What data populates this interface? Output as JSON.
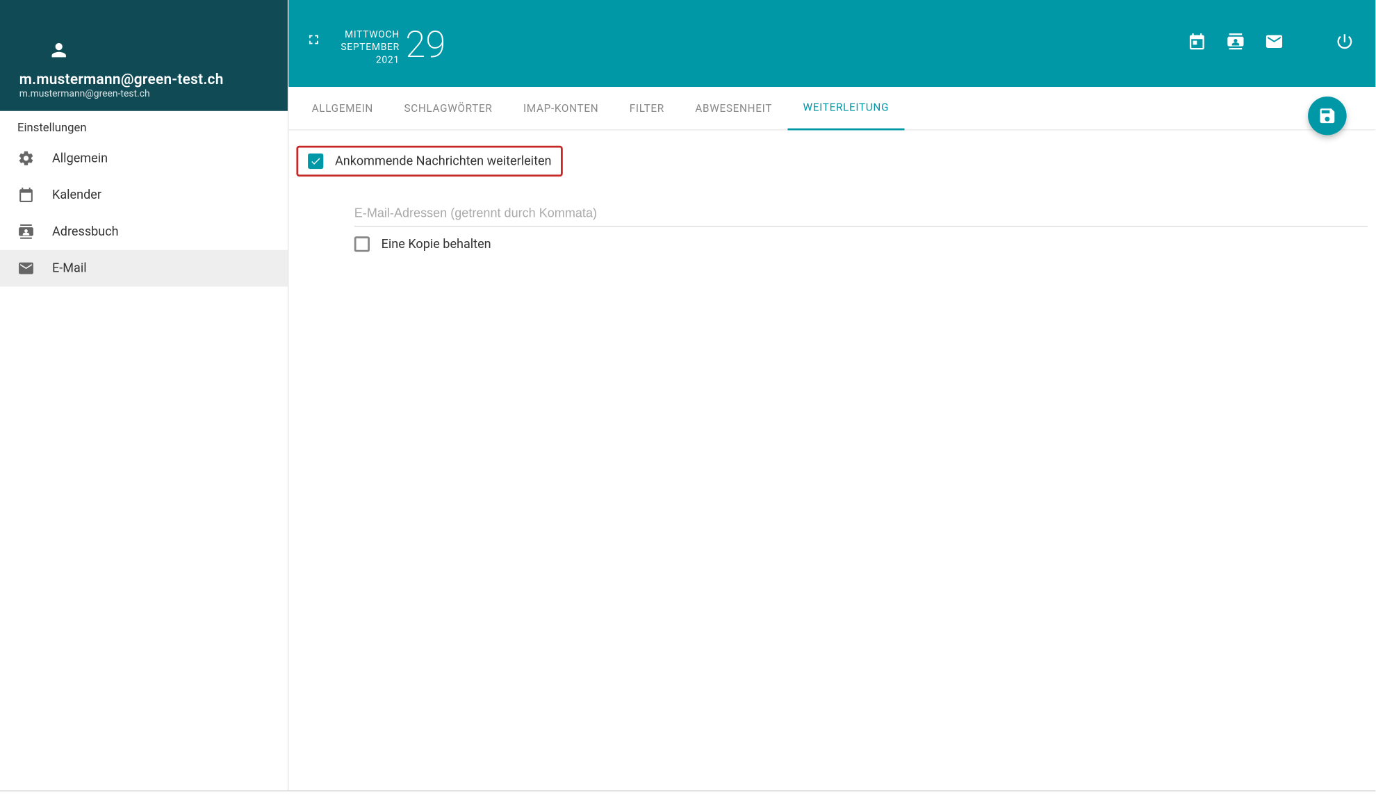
{
  "colors": {
    "primary": "#0097a7",
    "sidebar_header": "#104a55",
    "highlight": "#c62828"
  },
  "user": {
    "email": "m.mustermann@green-test.ch",
    "subemail": "m.mustermann@green-test.ch"
  },
  "sidebar": {
    "title": "Einstellungen",
    "items": [
      {
        "label": "Allgemein",
        "icon": "gear-icon",
        "active": false
      },
      {
        "label": "Kalender",
        "icon": "calendar-icon",
        "active": false
      },
      {
        "label": "Adressbuch",
        "icon": "contacts-icon",
        "active": false
      },
      {
        "label": "E-Mail",
        "icon": "mail-icon",
        "active": true
      }
    ]
  },
  "topbar": {
    "date": {
      "weekday": "MITTWOCH",
      "month": "SEPTEMBER",
      "year": "2021",
      "day": "29"
    }
  },
  "tabs": [
    {
      "label": "ALLGEMEIN",
      "active": false
    },
    {
      "label": "SCHLAGWÖRTER",
      "active": false
    },
    {
      "label": "IMAP-KONTEN",
      "active": false
    },
    {
      "label": "FILTER",
      "active": false
    },
    {
      "label": "ABWESENHEIT",
      "active": false
    },
    {
      "label": "WEITERLEITUNG",
      "active": true
    }
  ],
  "forwarding": {
    "enable_label": "Ankommende Nachrichten weiterleiten",
    "enable_checked": true,
    "email_placeholder": "E-Mail-Adressen (getrennt durch Kommata)",
    "email_value": "",
    "keep_copy_label": "Eine Kopie behalten",
    "keep_copy_checked": false
  }
}
